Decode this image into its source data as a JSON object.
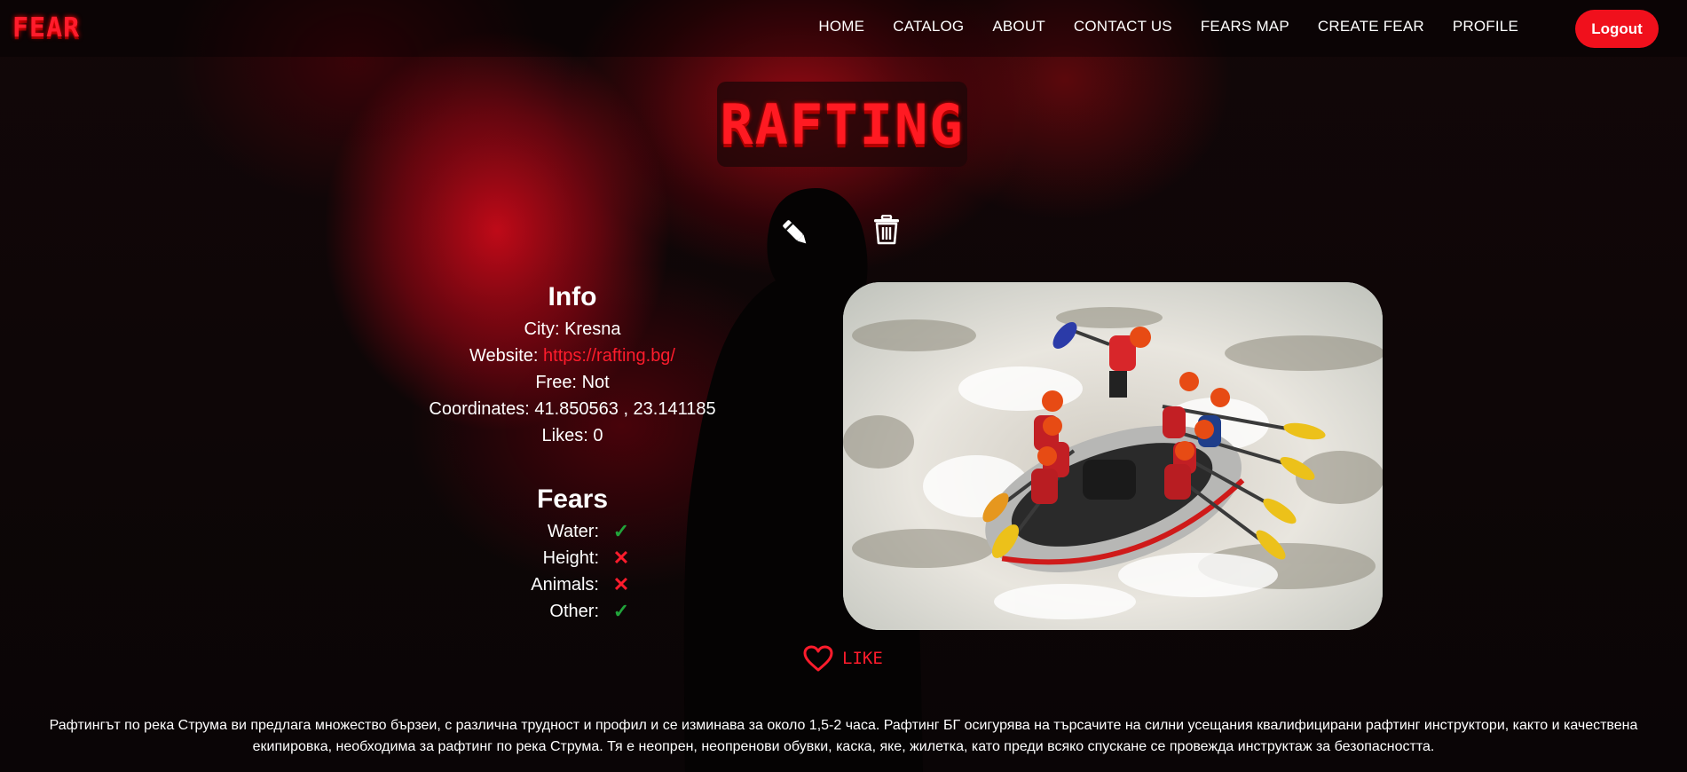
{
  "brand": {
    "logo": "FEAR"
  },
  "nav": {
    "items": [
      {
        "label": "HOME"
      },
      {
        "label": "CATALOG"
      },
      {
        "label": "ABOUT"
      },
      {
        "label": "CONTACT US"
      },
      {
        "label": "FEARS MAP"
      },
      {
        "label": "CREATE FEAR"
      },
      {
        "label": "PROFILE"
      }
    ],
    "logout_label": "Logout"
  },
  "fear": {
    "title": "RAFTING",
    "info": {
      "heading": "Info",
      "city_label": "City:",
      "city": "Kresna",
      "website_label": "Website:",
      "website": "https://rafting.bg/",
      "free_label": "Free:",
      "free": "Not",
      "coordinates_label": "Coordinates:",
      "coordinates": "41.850563 , 23.141185",
      "likes_label": "Likes:",
      "likes": "0"
    },
    "fears": {
      "heading": "Fears",
      "items": [
        {
          "label": "Water:",
          "checked": true,
          "mark": "✓"
        },
        {
          "label": "Height:",
          "checked": false,
          "mark": "✕"
        },
        {
          "label": "Animals:",
          "checked": false,
          "mark": "✕"
        },
        {
          "label": "Other:",
          "checked": true,
          "mark": "✓"
        }
      ]
    },
    "like_label": "LIKE",
    "description": "Рафтингът по река Струма ви предлага множество бързеи, с различна трудност и профил и се изминава за около 1,5-2 часа. Рафтинг БГ осигурява на търсачите на силни усещания квалифицирани рафтинг инструктори, както и качествена екипировка, необходима за рафтинг по река Струма. Тя е неопрен, неопренови обувки, каска, яке, жилетка, като преди всяко спускане се провежда инструктаж за безопасността."
  },
  "icons": [
    "edit-icon",
    "delete-icon",
    "heart-icon",
    "check-icon",
    "cross-icon"
  ],
  "colors": {
    "accent": "#ff1c2c",
    "check": "#21a33a",
    "logout": "#f0101c"
  }
}
